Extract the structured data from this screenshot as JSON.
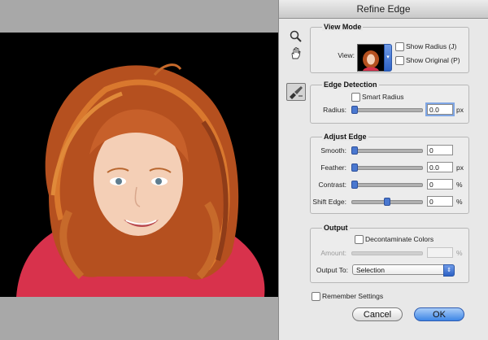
{
  "dialog": {
    "title": "Refine Edge",
    "view_mode": {
      "title": "View Mode",
      "view_label": "View:",
      "show_radius": "Show Radius (J)",
      "show_original": "Show Original (P)"
    },
    "edge_detection": {
      "title": "Edge Detection",
      "smart_radius": "Smart Radius",
      "radius_label": "Radius:",
      "radius_value": "0.0",
      "radius_unit": "px",
      "radius_level": 0
    },
    "adjust_edge": {
      "title": "Adjust Edge",
      "smooth_label": "Smooth:",
      "smooth_value": "0",
      "smooth_level": 0,
      "feather_label": "Feather:",
      "feather_value": "0.0",
      "feather_unit": "px",
      "feather_level": 0,
      "contrast_label": "Contrast:",
      "contrast_value": "0",
      "contrast_unit": "%",
      "contrast_level": 0,
      "shift_label": "Shift Edge:",
      "shift_value": "0",
      "shift_unit": "%",
      "shift_level": 0.5
    },
    "output": {
      "title": "Output",
      "decontaminate": "Decontaminate Colors",
      "amount_label": "Amount:",
      "amount_unit": "%",
      "output_to_label": "Output To:",
      "output_to_value": "Selection"
    },
    "remember": "Remember Settings",
    "cancel": "Cancel",
    "ok": "OK"
  },
  "icons": {
    "zoom": "zoom-tool-icon",
    "hand": "hand-tool-icon",
    "refine": "refine-radius-tool-icon"
  },
  "colors": {
    "accent": "#3d86e6",
    "dialog_bg": "#e8e8e8",
    "canvas_bg": "#a8a8a8"
  }
}
